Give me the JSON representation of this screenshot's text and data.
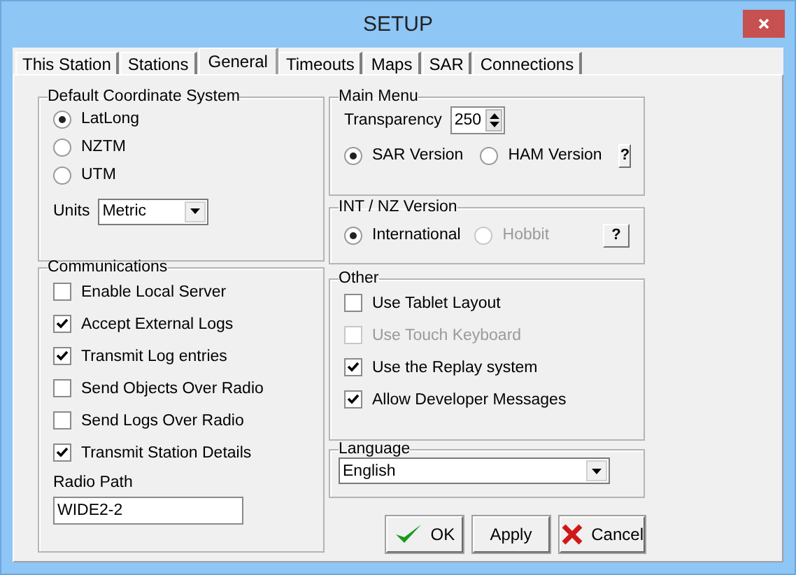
{
  "window": {
    "title": "SETUP"
  },
  "tabs": [
    {
      "label": "This Station",
      "selected": false
    },
    {
      "label": "Stations",
      "selected": false
    },
    {
      "label": "General",
      "selected": true
    },
    {
      "label": "Timeouts",
      "selected": false
    },
    {
      "label": "Maps",
      "selected": false
    },
    {
      "label": "SAR",
      "selected": false
    },
    {
      "label": "Connections",
      "selected": false
    }
  ],
  "coordinate_system": {
    "title": "Default Coordinate System",
    "options": [
      {
        "label": "LatLong",
        "selected": true
      },
      {
        "label": "NZTM",
        "selected": false
      },
      {
        "label": "UTM",
        "selected": false
      }
    ],
    "units": {
      "label": "Units",
      "value": "Metric"
    }
  },
  "communications": {
    "title": "Communications",
    "options": [
      {
        "label": "Enable Local Server",
        "checked": false
      },
      {
        "label": "Accept External Logs",
        "checked": true
      },
      {
        "label": "Transmit Log entries",
        "checked": true
      },
      {
        "label": "Send Objects Over Radio",
        "checked": false
      },
      {
        "label": "Send Logs Over Radio",
        "checked": false
      },
      {
        "label": "Transmit Station Details",
        "checked": true
      }
    ],
    "radio_path": {
      "label": "Radio Path",
      "value": "WIDE2-2"
    }
  },
  "main_menu": {
    "title": "Main Menu",
    "transparency": {
      "label": "Transparency",
      "value": "250"
    },
    "versions": [
      {
        "label": "SAR Version",
        "selected": true
      },
      {
        "label": "HAM Version",
        "selected": false
      }
    ],
    "help": "?"
  },
  "int_nz": {
    "title": "INT / NZ Version",
    "options": [
      {
        "label": "International",
        "selected": true,
        "disabled": false
      },
      {
        "label": "Hobbit",
        "selected": false,
        "disabled": true
      }
    ],
    "help": "?"
  },
  "other": {
    "title": "Other",
    "options": [
      {
        "label": "Use Tablet Layout",
        "checked": false,
        "disabled": false
      },
      {
        "label": "Use Touch Keyboard",
        "checked": false,
        "disabled": true
      },
      {
        "label": "Use the Replay system",
        "checked": true,
        "disabled": false
      },
      {
        "label": "Allow Developer Messages",
        "checked": true,
        "disabled": false
      }
    ]
  },
  "language": {
    "title": "Language",
    "value": "English"
  },
  "buttons": [
    {
      "label": "OK",
      "kind": "ok"
    },
    {
      "label": "Apply",
      "kind": "plain"
    },
    {
      "label": "Cancel",
      "kind": "cancel"
    }
  ]
}
